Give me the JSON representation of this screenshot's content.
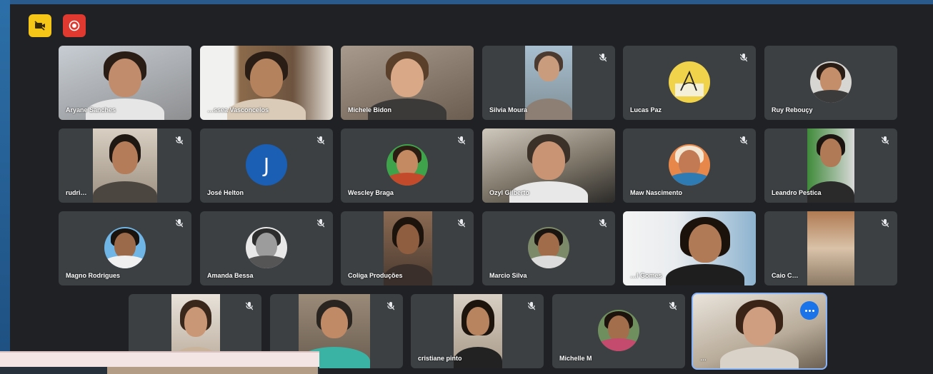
{
  "toolbar": {
    "icons": [
      "camera-off-icon",
      "record-icon"
    ],
    "colors": {
      "camera_off": "#f5c518",
      "record": "#e0392f"
    }
  },
  "active_tile_color": "#8ab4f8",
  "participants": [
    {
      "name": "Aryane Sanches",
      "muted": false,
      "video": true
    },
    {
      "name": "…ssea Vasconcelos",
      "muted": false,
      "video": true
    },
    {
      "name": "Michele Bidon",
      "muted": false,
      "video": true
    },
    {
      "name": "Silvia Moura",
      "muted": true,
      "video": true
    },
    {
      "name": "Lucas Paz",
      "muted": true,
      "video": false
    },
    {
      "name": "Ruy Rebouçy",
      "muted": false,
      "video": false
    },
    {
      "name": "rudri…",
      "muted": true,
      "video": true
    },
    {
      "name": "José Helton",
      "muted": true,
      "video": false,
      "initial": "J"
    },
    {
      "name": "Wescley Braga",
      "muted": true,
      "video": false
    },
    {
      "name": "Ozyl Gilberto",
      "muted": false,
      "video": true
    },
    {
      "name": "Maw Nascimento",
      "muted": true,
      "video": false
    },
    {
      "name": "Leandro Pestica",
      "muted": true,
      "video": true
    },
    {
      "name": "Magno Rodrigues",
      "muted": true,
      "video": false
    },
    {
      "name": "Amanda Bessa",
      "muted": true,
      "video": false
    },
    {
      "name": "Coliga Produções",
      "muted": true,
      "video": true
    },
    {
      "name": "Marcio Silva",
      "muted": true,
      "video": false
    },
    {
      "name": "…l Gomes",
      "muted": false,
      "video": true
    },
    {
      "name": "Caio C…",
      "muted": true,
      "video": true
    },
    {
      "name": "",
      "muted": true,
      "video": true
    },
    {
      "name": "",
      "muted": true,
      "video": true
    },
    {
      "name": "cristiane pinto",
      "muted": true,
      "video": true
    },
    {
      "name": "Michelle M",
      "muted": true,
      "video": false
    },
    {
      "name": "…",
      "muted": false,
      "video": true,
      "active": true
    }
  ]
}
